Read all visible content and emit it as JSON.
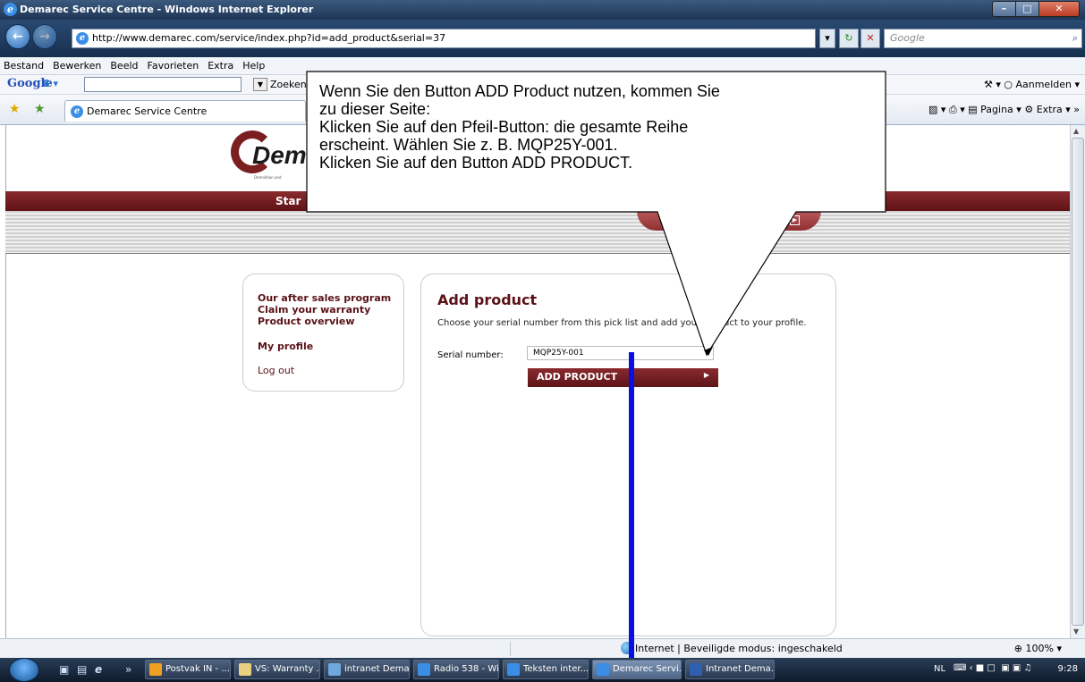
{
  "window": {
    "title": "Demarec Service Centre - Windows Internet Explorer"
  },
  "address": {
    "url": "http://www.demarec.com/service/index.php?id=add_product&serial=37",
    "search_placeholder": "Google"
  },
  "menubar": [
    "Bestand",
    "Bewerken",
    "Beeld",
    "Favorieten",
    "Extra",
    "Help"
  ],
  "googlebar": {
    "logo": "Google",
    "search_button": "Zoeken",
    "signin": "Aanmelden"
  },
  "tab": {
    "title": "Demarec Service Centre"
  },
  "commandbar": {
    "page": "Pagina",
    "extra": "Extra"
  },
  "site": {
    "logo_text": "Dem",
    "logo_sub": "Demolition and",
    "nav_start": "Star"
  },
  "sidebar": {
    "items": [
      {
        "label": "Our after sales program",
        "bold": true
      },
      {
        "label": "Claim your warranty",
        "bold": true
      },
      {
        "label": "Product overview",
        "bold": true
      },
      {
        "label": "My profile",
        "bold": true
      },
      {
        "label": "Log out",
        "bold": false
      }
    ]
  },
  "main": {
    "title": "Add product",
    "description": "Choose your serial number from this pick list and add your product to your profile.",
    "serial_label": "Serial number:",
    "serial_value": "MQP25Y-001",
    "add_button": "ADD PRODUCT"
  },
  "callout": {
    "lines": [
      "Wenn Sie den Button ADD Product nutzen, kommen Sie",
      "zu dieser Seite:",
      "Klicken Sie auf den Pfeil-Button: die gesamte Reihe",
      "erscheint. Wählen Sie z. B. MQP25Y-001.",
      "Klicken Sie auf den Button ADD PRODUCT."
    ]
  },
  "statusbar": {
    "text": "Internet | Beveiligde modus: ingeschakeld",
    "zoom": "100%"
  },
  "taskbar": {
    "buttons": [
      {
        "label": "Postvak IN - ...",
        "icon_color": "#f0a020"
      },
      {
        "label": "VS: Warranty ...",
        "icon_color": "#e8d080"
      },
      {
        "label": "intranet Dema...",
        "icon_color": "#6fa8dc"
      },
      {
        "label": "Radio 538 - Wi...",
        "icon_color": "#3a8ee6"
      },
      {
        "label": "Teksten inter...",
        "icon_color": "#3a8ee6"
      },
      {
        "label": "Demarec Servi...",
        "icon_color": "#3a8ee6"
      },
      {
        "label": "Intranet Dema...",
        "icon_color": "#2f5fb0"
      }
    ],
    "language": "NL",
    "clock": "9:28"
  },
  "colors": {
    "brand": "#5a1216",
    "callout_pointer_line": "#0a10e0"
  }
}
